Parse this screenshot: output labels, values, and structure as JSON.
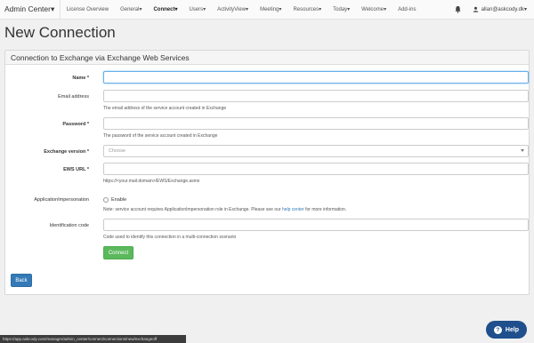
{
  "navbar": {
    "brand": "Admin Center▾",
    "items": [
      {
        "label": "License Overview"
      },
      {
        "label": "General▾"
      },
      {
        "label": "Connect▾"
      },
      {
        "label": "Users▾"
      },
      {
        "label": "ActivityView▾"
      },
      {
        "label": "Meeting▾"
      },
      {
        "label": "Resources▾"
      },
      {
        "label": "Today▾"
      },
      {
        "label": "Welcome▾"
      },
      {
        "label": "Add-ins"
      }
    ],
    "active_index": 2,
    "user": "allan@askcody.dk▾"
  },
  "page": {
    "title": "New Connection"
  },
  "panel": {
    "heading": "Connection to Exchange via Exchange Web Services",
    "fields": {
      "name": {
        "label": "Name *",
        "value": ""
      },
      "email": {
        "label": "Email address",
        "value": "",
        "help": "The email address of the service account created in Exchange"
      },
      "password": {
        "label": "Password *",
        "value": "",
        "help": "The password of the service account created in Exchange"
      },
      "exchange_version": {
        "label": "Exchange version *",
        "selected": "Choose"
      },
      "ews_url": {
        "label": "EWS URL *",
        "value": "",
        "help": "https://<your.mail.domain>/EWS/Exchange.asmx"
      },
      "impersonation": {
        "label": "ApplicationImpersonation",
        "option": "Enable",
        "help_before": "Note: service account requires ApplicationImpersonation role in Exchange. Please see our ",
        "help_link": "help center",
        "help_after": " for more information."
      },
      "identification_code": {
        "label": "Identification code",
        "value": "",
        "help": "Code used to identify this connection in a multi-connection scenario"
      }
    },
    "connect_button": "Connect"
  },
  "back_button": "Back",
  "status_url": "https://app.askcody.com/manager/admin_center/connect/connections/new/exchangeoff",
  "help_widget": {
    "label": "Help",
    "icon": "?"
  }
}
